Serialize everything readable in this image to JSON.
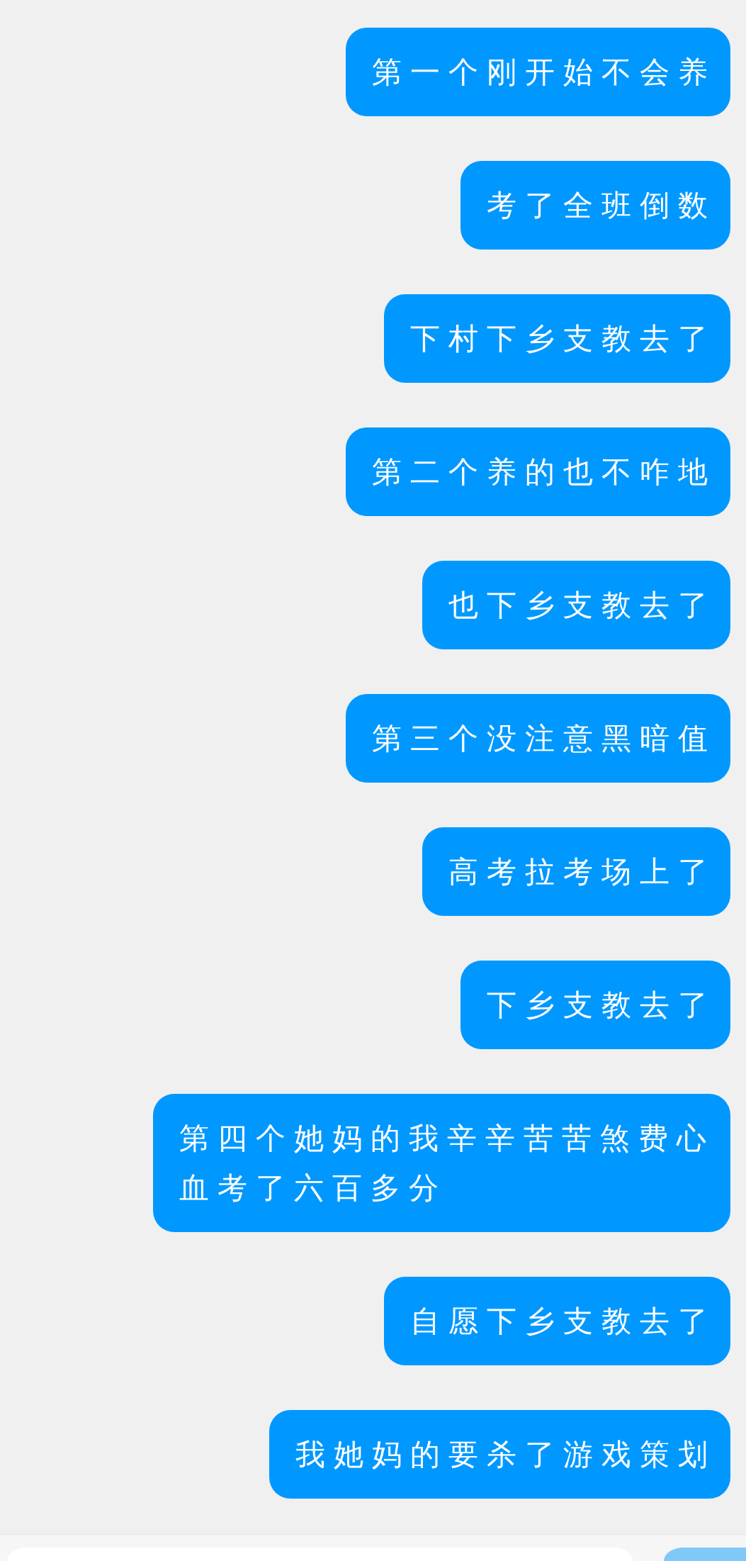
{
  "messages": [
    {
      "text": "第一个刚开始不会养"
    },
    {
      "text": "考了全班倒数"
    },
    {
      "text": "下村下乡支教去了"
    },
    {
      "text": "第二个养的也不咋地"
    },
    {
      "text": "也下乡支教去了"
    },
    {
      "text": "第三个没注意黑暗值"
    },
    {
      "text": "高考拉考场上了"
    },
    {
      "text": "下乡支教去了"
    },
    {
      "text": "第四个她妈的我辛辛苦苦煞费心血考了六百多分"
    },
    {
      "text": "自愿下乡支教去了"
    },
    {
      "text": "我她妈的要杀了游戏策划"
    }
  ],
  "send_button": {
    "disabled": true
  }
}
